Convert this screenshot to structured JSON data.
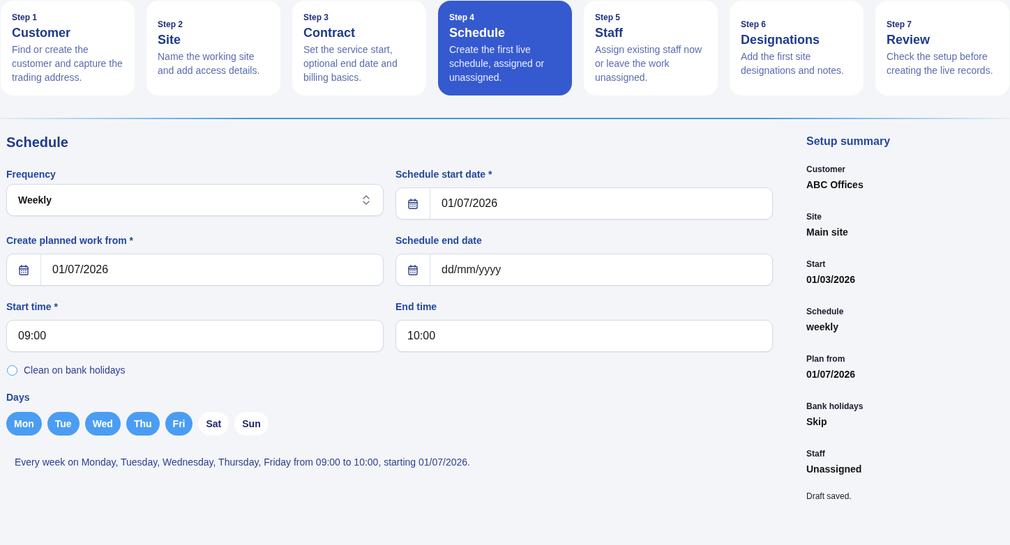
{
  "steps": [
    {
      "step": "Step 1",
      "title": "Customer",
      "description": "Find or create the customer and capture the trading address.",
      "selected": false
    },
    {
      "step": "Step 2",
      "title": "Site",
      "description": "Name the working site and add access details.",
      "selected": false
    },
    {
      "step": "Step 3",
      "title": "Contract",
      "description": "Set the service start, optional end date and billing basics.",
      "selected": false
    },
    {
      "step": "Step 4",
      "title": "Schedule",
      "description": "Create the first live schedule, assigned or unassigned.",
      "selected": true
    },
    {
      "step": "Step 5",
      "title": "Staff",
      "description": "Assign existing staff now or leave the work unassigned.",
      "selected": false
    },
    {
      "step": "Step 6",
      "title": "Designations",
      "description": "Add the first site designations and notes.",
      "selected": false
    },
    {
      "step": "Step 7",
      "title": "Review",
      "description": "Check the setup before creating the live records.",
      "selected": false
    }
  ],
  "form": {
    "heading": "Schedule",
    "fields": [
      {
        "kind": "select",
        "label": "Frequency",
        "value": "Weekly"
      },
      {
        "kind": "date",
        "label": "Schedule start date *",
        "value": "01/07/2026"
      },
      {
        "kind": "date",
        "label": "Create planned work from *",
        "value": "01/07/2026"
      },
      {
        "kind": "date",
        "label": "Schedule end date",
        "placeholder": "dd/mm/yyyy"
      },
      {
        "kind": "time",
        "label": "Start time *",
        "value": "09:00"
      },
      {
        "kind": "time",
        "label": "End time",
        "value": "10:00"
      }
    ],
    "bank_holidays": {
      "label": "Clean on bank holidays",
      "checked": false
    },
    "days": {
      "label": "Days",
      "items": [
        {
          "label": "Mon",
          "selected": true
        },
        {
          "label": "Tue",
          "selected": true
        },
        {
          "label": "Wed",
          "selected": true
        },
        {
          "label": "Thu",
          "selected": true
        },
        {
          "label": "Fri",
          "selected": true
        },
        {
          "label": "Sat",
          "selected": false
        },
        {
          "label": "Sun",
          "selected": false
        }
      ]
    },
    "summary_text": "Every week on Monday, Tuesday, Wednesday, Thursday, Friday from 09:00 to 10:00, starting 01/07/2026."
  },
  "summary": {
    "title": "Setup summary",
    "items": [
      {
        "label": "Customer",
        "value": "ABC Offices"
      },
      {
        "label": "Site",
        "value": "Main site"
      },
      {
        "label": "Start",
        "value": "01/03/2026"
      },
      {
        "label": "Schedule",
        "value": "weekly"
      },
      {
        "label": "Plan from",
        "value": "01/07/2026"
      },
      {
        "label": "Bank holidays",
        "value": "Skip"
      },
      {
        "label": "Staff",
        "value": "Unassigned"
      }
    ],
    "status": "Draft saved."
  }
}
